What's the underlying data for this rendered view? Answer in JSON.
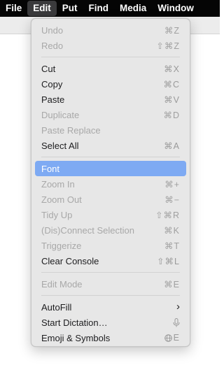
{
  "menubar": {
    "items": [
      "File",
      "Edit",
      "Put",
      "Find",
      "Media",
      "Window"
    ]
  },
  "edit_menu": {
    "undo": {
      "label": "Undo",
      "shortcut": "⌘Z"
    },
    "redo": {
      "label": "Redo",
      "shortcut": "⇧⌘Z"
    },
    "cut": {
      "label": "Cut",
      "shortcut": "⌘X"
    },
    "copy": {
      "label": "Copy",
      "shortcut": "⌘C"
    },
    "paste": {
      "label": "Paste",
      "shortcut": "⌘V"
    },
    "duplicate": {
      "label": "Duplicate",
      "shortcut": "⌘D"
    },
    "paste_replace": {
      "label": "Paste Replace"
    },
    "select_all": {
      "label": "Select All",
      "shortcut": "⌘A"
    },
    "font": {
      "label": "Font"
    },
    "zoom_in": {
      "label": "Zoom In",
      "shortcut": "⌘+"
    },
    "zoom_out": {
      "label": "Zoom Out",
      "shortcut": "⌘−"
    },
    "tidy_up": {
      "label": "Tidy Up",
      "shortcut": "⇧⌘R"
    },
    "disconnect_selection": {
      "label": "(Dis)Connect Selection",
      "shortcut": "⌘K"
    },
    "triggerize": {
      "label": "Triggerize",
      "shortcut": "⌘T"
    },
    "clear_console": {
      "label": "Clear Console",
      "shortcut": "⇧⌘L"
    },
    "edit_mode": {
      "label": "Edit Mode",
      "shortcut": "⌘E"
    },
    "autofill": {
      "label": "AutoFill"
    },
    "start_dictation": {
      "label": "Start Dictation…"
    },
    "emoji_symbols": {
      "label": "Emoji & Symbols",
      "shortcut_suffix": "E"
    }
  },
  "icons": {
    "submenu": "chevron-right-icon",
    "dictation": "microphone-icon",
    "emoji": "globe-icon"
  },
  "colors": {
    "menubar_bg": "#050505",
    "menu_bg": "#e7e7e7",
    "highlight": "#7eaaf3",
    "disabled_text": "#a8a8a8"
  }
}
